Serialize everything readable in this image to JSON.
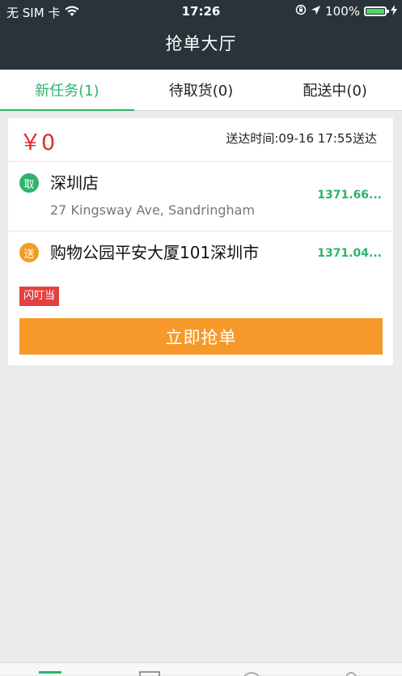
{
  "status_bar": {
    "carrier": "无 SIM 卡",
    "time": "17:26",
    "battery": "100%",
    "battery_color": "#4cd964"
  },
  "nav": {
    "title": "抢单大厅"
  },
  "tabs": [
    {
      "label": "新任务(1)",
      "active": true
    },
    {
      "label": "待取货(0)",
      "active": false
    },
    {
      "label": "配送中(0)",
      "active": false
    }
  ],
  "order": {
    "price": "￥0",
    "deliver_time": "送达时间:09-16 17:55送达",
    "pickup": {
      "badge": "取",
      "name": "深圳店",
      "address": "27 Kingsway Ave, Sandringham",
      "distance": "1371.66..."
    },
    "dropoff": {
      "badge": "送",
      "name": "购物公园平安大厦101深圳市",
      "distance": "1371.04..."
    },
    "tag": "闪叮当",
    "grab_button": "立即抢单"
  },
  "colors": {
    "accent_green": "#2db36a",
    "price_red": "#e12b2b",
    "button_orange": "#f6992a",
    "nav_bg": "#28343a",
    "tag_red": "#e2413f"
  }
}
